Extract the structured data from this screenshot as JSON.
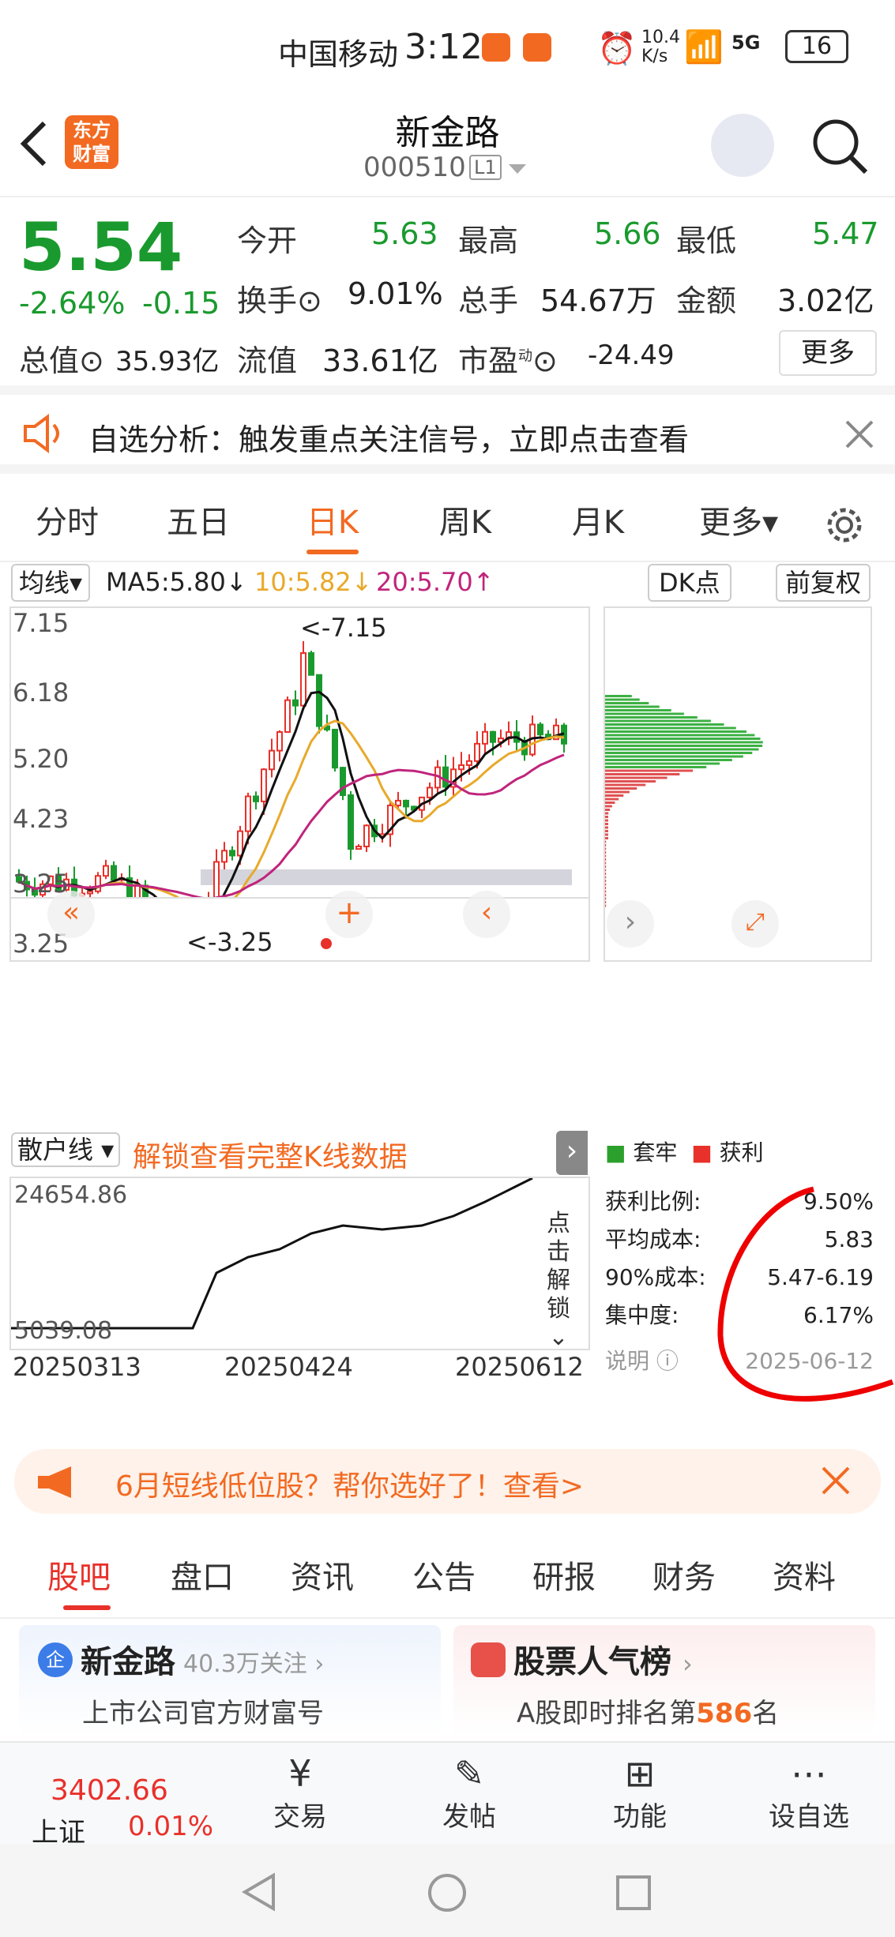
{
  "status": {
    "carrier": "中国移动",
    "time": "3:12",
    "speed_top": "10.4",
    "speed_unit": "K/s",
    "net_tag": "5G",
    "battery": "16"
  },
  "header": {
    "back": "back",
    "logo_line1": "东方",
    "logo_line2": "财富",
    "title": "新金路",
    "code": "000510",
    "level": "L1"
  },
  "quote": {
    "price": "5.54",
    "pct": "-2.64%",
    "chg": "-0.15",
    "open_label": "今开",
    "open": "5.63",
    "high_label": "最高",
    "high": "5.66",
    "low_label": "最低",
    "low": "5.47",
    "turnover_label": "换手",
    "turnover": "9.01%",
    "volume_label": "总手",
    "volume": "54.67万",
    "amount_label": "金额",
    "amount": "3.02亿",
    "mktcap_label": "总值",
    "mktcap": "35.93亿",
    "float_label": "流值",
    "float": "33.61亿",
    "pe_label": "市盈",
    "pe_sup": "动",
    "pe": "-24.49",
    "more": "更多"
  },
  "notice": {
    "text": "自选分析：触发重点关注信号，立即点击查看"
  },
  "tabs": [
    "分时",
    "五日",
    "日K",
    "周K",
    "月K",
    "更多▾"
  ],
  "chart": {
    "ma_toggle": "均线▾",
    "ma5": "MA5:5.80↓",
    "ma10": "10:5.82↓",
    "ma20": "20:5.70↑",
    "dk": "DK点",
    "adj": "前复权",
    "ticks": [
      "7.15",
      "6.18",
      "5.20",
      "4.23",
      "3.25"
    ],
    "high_mark": "<-7.15",
    "low_mark": "<-3.25"
  },
  "chart_data": {
    "type": "candlestick",
    "y_ticks": [
      7.15,
      6.18,
      5.2,
      4.23,
      3.25
    ],
    "period_high": 7.15,
    "period_low": 3.25,
    "ma": {
      "MA5": 5.8,
      "MA10": 5.82,
      "MA20": 5.7
    },
    "retail_line": {
      "name": "散户线",
      "ymax": 24654.86,
      "ymin": 5039.08,
      "x_ticks": [
        "20250313",
        "20250424",
        "20250612"
      ]
    }
  },
  "sub": {
    "toggle": "散户线 ▾",
    "unlock": "解锁查看完整K线数据",
    "ymax": "24654.86",
    "ymin": "5039.08",
    "x1": "20250313",
    "x2": "20250424",
    "x3": "20250612",
    "side": "点击解锁"
  },
  "chip": {
    "legend_a": "套牢",
    "legend_b": "获利",
    "rows": [
      {
        "k": "获利比例:",
        "v": "9.50%"
      },
      {
        "k": "平均成本:",
        "v": "5.83"
      },
      {
        "k": "90%成本:",
        "v": "5.47-6.19"
      },
      {
        "k": "集中度:",
        "v": "6.17%"
      }
    ],
    "note": "说明",
    "date": "2025-06-12"
  },
  "promo": {
    "text": "6月短线低位股？帮你选好了！查看>"
  },
  "ctabs": [
    "股吧",
    "盘口",
    "资讯",
    "公告",
    "研报",
    "财务",
    "资料"
  ],
  "cards": {
    "left_title": "新金路",
    "left_follow": "40.3万关注",
    "left_sub": "上市公司官方财富号",
    "right_title": "股票人气榜",
    "right_sub_a": "A股即时排名第",
    "right_rank": "586",
    "right_sub_b": "名"
  },
  "nav": {
    "index_val": "3402.66",
    "index_name": "上证",
    "index_pct": "0.01%",
    "items": [
      "交易",
      "发帖",
      "功能",
      "设自选"
    ]
  },
  "colors": {
    "up": "#e8312a",
    "down": "#1a9a2e",
    "accent": "#f26a22"
  }
}
